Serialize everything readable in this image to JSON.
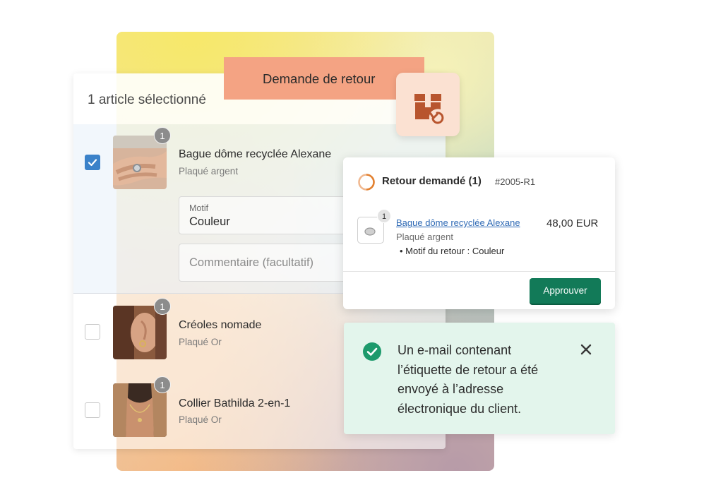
{
  "banner": {
    "title": "Demande de retour"
  },
  "return_icon": "box-return-icon",
  "list": {
    "count_label": "1 article sélectionné",
    "items": [
      {
        "name": "Bague dôme recyclée Alexane",
        "variant": "Plaqué argent",
        "quantity": "1",
        "checked": true,
        "image": "ring-on-hand-photo"
      },
      {
        "name": "Créoles nomade",
        "variant": "Plaqué Or",
        "quantity": "1",
        "checked": false,
        "image": "earring-photo"
      },
      {
        "name": "Collier Bathilda 2-en-1",
        "variant": "Plaqué Or",
        "quantity": "1",
        "checked": false,
        "image": "necklace-photo"
      }
    ],
    "reason_field": {
      "label": "Motif",
      "value": "Couleur"
    },
    "comment_field": {
      "placeholder": "Commentaire (facultatif)"
    }
  },
  "detail": {
    "status_title": "Retour demandé (1)",
    "order_ref": "#2005-R1",
    "item": {
      "quantity": "1",
      "name": "Bague dôme recyclée Alexane",
      "price": "48,00 EUR",
      "variant": "Plaqué argent",
      "reason": "Motif du retour : Couleur"
    },
    "approve_label": "Approuver"
  },
  "toast": {
    "message": "Un e-mail contenant l’étiquette de retour a été envoyé à l’adresse électronique du client.",
    "icon": "check-circle-icon",
    "close_icon": "close-icon"
  },
  "colors": {
    "checkbox_checked": "#3b82c9",
    "approve_button": "#127a58",
    "banner": "#f4a383",
    "toast_bg": "#e3f5ec",
    "success_icon": "#1d9a6c",
    "link": "#2f6ab5"
  }
}
